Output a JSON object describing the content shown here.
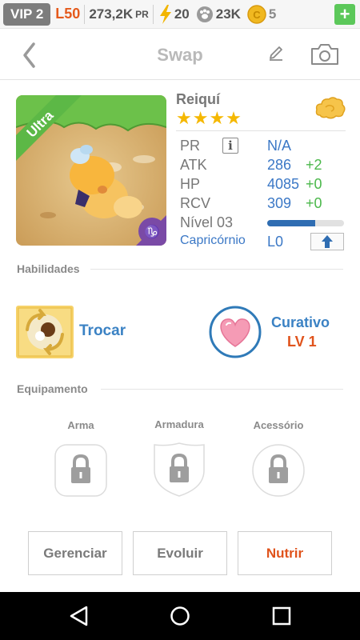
{
  "status_bar": {
    "vip": "VIP 2",
    "level": "L50",
    "power_value": "273,2K",
    "power_unit": "PR",
    "energy": "20",
    "paw_count": "23K",
    "coins": "5",
    "add_label": "+"
  },
  "header": {
    "title": "Swap"
  },
  "monster": {
    "rarity": "Ultra",
    "name": "Reiquí",
    "stars": "★★★★",
    "element": "mystic"
  },
  "stats": {
    "pr_label": "PR",
    "pr_info": "i",
    "pr_value": "N/A",
    "atk_label": "ATK",
    "atk_value": "286",
    "atk_plus": "+2",
    "hp_label": "HP",
    "hp_value": "4085",
    "hp_plus": "+0",
    "rcv_label": "RCV",
    "rcv_value": "309",
    "rcv_plus": "+0",
    "level_label": "Nível 03",
    "level_progress": 0.62,
    "sign_label": "Capricórnio",
    "sign_level": "L0"
  },
  "abilities": {
    "section_title": "Habilidades",
    "skill_name": "Trocar",
    "passive_name": "Curativo",
    "passive_level": "LV 1"
  },
  "equipment": {
    "section_title": "Equipamento",
    "weapon_label": "Arma",
    "armor_label": "Armadura",
    "accessory_label": "Acessório"
  },
  "actions": {
    "manage_label": "Gerenciar",
    "evolve_label": "Evoluir",
    "feed_label": "Nutrir"
  },
  "colors": {
    "accent_blue": "#3b82c4",
    "accent_orange": "#e0531c",
    "green": "#5cc85a",
    "star": "#f5b800"
  }
}
